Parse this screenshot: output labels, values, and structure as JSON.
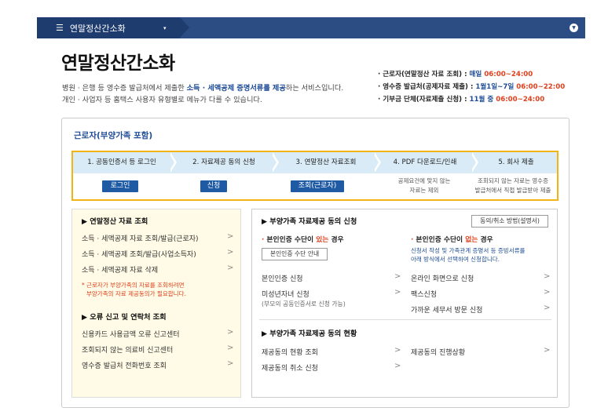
{
  "topbar": {
    "menu_label": "연말정산간소화",
    "menu_icon": "hamburger-icon",
    "caret": "▾",
    "right_icon": "chevron-down-circle-icon"
  },
  "page": {
    "title": "연말정산간소화",
    "desc_line1_a": "병원 · 은행 등 영수증 발급처에서 제출한 ",
    "desc_line1_b": "소득 · 세액공제 증명서류를 제공",
    "desc_line1_c": "하는 서비스입니다.",
    "desc_line2": "개인 · 사업자 등 홈택스 사용자 유형별로 메뉴가 다를 수 있습니다."
  },
  "schedule": [
    {
      "bullet": "·",
      "label": "근로자(연말정산 자료 조회) : ",
      "when": "매일",
      "time": " 06:00~24:00"
    },
    {
      "bullet": "·",
      "label": "영수증 발급처(공제자료 제출) : ",
      "when": "1월1일~7일",
      "time": " 06:00~22:00"
    },
    {
      "bullet": "·",
      "label": "기부금 단체(자료제출 신청) : ",
      "when": "11월 중",
      "time": " 06:00~24:00"
    }
  ],
  "panel": {
    "title": "근로자(부양가족 포함)",
    "steps": [
      {
        "label": "1. 공동인증서 등 로그인",
        "button": "로그인"
      },
      {
        "label": "2. 자료제공 동의 신청",
        "button": "신청"
      },
      {
        "label": "3. 연말정산 자료조회",
        "button": "조회(근로자)"
      },
      {
        "label": "4. PDF 다운로드/인쇄",
        "note1": "공제요건에 맞지 않는",
        "note2": "자료는 제외"
      },
      {
        "label": "5. 회사 제출",
        "note1": "조회되지 않는 자료는 영수증",
        "note2": "발급처에서 직접 발급받아 제출"
      }
    ]
  },
  "left": {
    "section1_title": "▶ 연말정산 자료 조회",
    "items1": [
      "소득 · 세액공제 자료 조회/발급(근로자)",
      "소득 · 세액공제 조회/발급(사업소득자)",
      "소득 · 세액공제 자료 삭제"
    ],
    "note1": "* 근로자가 부양가족의 자료를 조회하려면",
    "note2": "부양가족의 자료 제공동의가 필요합니다.",
    "section2_title": "▶ 오류 신고 및 연락처 조회",
    "items2": [
      "신용카드 사용금액 오류 신고센터",
      "조회되지 않는 의료비 신고센터",
      "영수증 발급처 전화번호 조회"
    ],
    "chevron": ">"
  },
  "right": {
    "section1_title": "▶ 부양가족 자료제공 동의 신청",
    "method_button": "동의/취소 방법(설명서)",
    "has_cert_a": "본인인증 수단이 ",
    "has_cert_b": "있는",
    "has_cert_c": " 경우",
    "no_cert_a": "본인인증 수단이 ",
    "no_cert_b": "없는",
    "no_cert_c": " 경우",
    "cert_guide_button": "본인인증 수단 안내",
    "no_cert_note1": "신청서 작성 및 가족관계 증명서 등 증빙서류를",
    "no_cert_note2": "아래 방식에서 선택하여 신청합니다.",
    "left_items": [
      "본인인증 신청",
      "미성년자녀 신청"
    ],
    "minor_note": "(부모의 공동인증서로 신청 가능)",
    "right_items": [
      "온라인 화면으로 신청",
      "팩스신청",
      "가까운 세무서 방문 신청"
    ],
    "section2_title": "▶ 부양가족 자료제공 동의 현황",
    "status_left": [
      "제공동의 현황 조회",
      "제공동의 취소 신청"
    ],
    "status_right": [
      "제공동의 진행상황"
    ],
    "dot": "·",
    "chevron": ">"
  }
}
